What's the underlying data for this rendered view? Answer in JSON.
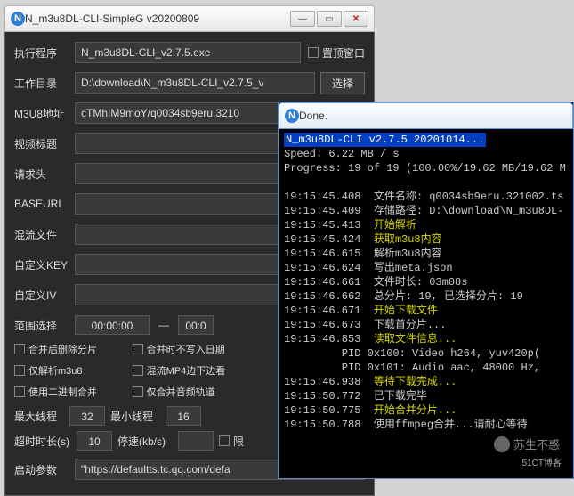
{
  "mainWindow": {
    "title": "N_m3u8DL-CLI-SimpleG v20200809",
    "rows": {
      "exePath": {
        "label": "执行程序",
        "value": "N_m3u8DL-CLI_v2.7.5.exe"
      },
      "topmost": {
        "label": "置顶窗口"
      },
      "workDir": {
        "label": "工作目录",
        "value": "D:\\download\\N_m3u8DL-CLI_v2.7.5_v",
        "btn": "选择"
      },
      "m3u8": {
        "label": "M3U8地址",
        "value": "cTMhIM9moY/q0034sb9eru.3210"
      },
      "videoTitle": {
        "label": "视频标题",
        "value": ""
      },
      "headers": {
        "label": "请求头",
        "value": ""
      },
      "baseurl": {
        "label": "BASEURL",
        "value": ""
      },
      "muxFile": {
        "label": "混流文件",
        "value": ""
      },
      "customKey": {
        "label": "自定义KEY",
        "value": ""
      },
      "customIV": {
        "label": "自定义IV",
        "value": ""
      }
    },
    "range": {
      "label": "范围选择",
      "from": "00:00:00",
      "to": "00:0"
    },
    "checks": {
      "c1": "合并后删除分片",
      "c2": "合并时不写入日期",
      "c3": "",
      "c4": "仅解析m3u8",
      "c5": "混流MP4边下边看",
      "c6": "",
      "c7": "使用二进制合并",
      "c8": "仅合并音频轨道",
      "c9": ""
    },
    "nums": {
      "maxThreadsL": "最大线程",
      "maxThreads": "32",
      "minThreadsL": "最小线程",
      "minThreads": "16",
      "timeoutL": "超时时长(s)",
      "timeout": "10",
      "speedL": "停速(kb/s)",
      "speed": "",
      "limitChk": "限"
    },
    "args": {
      "label": "启动参数",
      "value": "\"https://defaultts.tc.qq.com/defa"
    }
  },
  "consoleWindow": {
    "title": "Done.",
    "header": "N_m3u8DL-CLI v2.7.5 20201014...",
    "speed": "Speed: 6.22 MB / s",
    "progress": "Progress: 19 of 19 (100.00%/19.62 MB/19.62 M",
    "lines": [
      {
        "t": "19:15:45.408",
        "m": "文件名称: q0034sb9eru.321002.ts"
      },
      {
        "t": "19:15:45.409",
        "m": "存储路径: D:\\download\\N_m3u8DL-"
      },
      {
        "t": "19:15:45.413",
        "m": "开始解析",
        "y": true
      },
      {
        "t": "19:15:45.424",
        "m": "获取m3u8内容",
        "y": true
      },
      {
        "t": "19:15:46.615",
        "m": "解析m3u8内容"
      },
      {
        "t": "19:15:46.624",
        "m": "写出meta.json"
      },
      {
        "t": "19:15:46.661",
        "m": "文件时长: 03m08s"
      },
      {
        "t": "19:15:46.662",
        "m": "总分片: 19, 已选择分片: 19"
      },
      {
        "t": "19:15:46.671",
        "m": "开始下载文件",
        "y": true
      },
      {
        "t": "19:15:46.673",
        "m": "下载首分片..."
      },
      {
        "t": "19:15:46.853",
        "m": "读取文件信息...",
        "y": true
      },
      {
        "t": "",
        "m": "         PID 0x100: Video h264, yuv420p("
      },
      {
        "t": "",
        "m": "         PID 0x101: Audio aac, 48000 Hz,"
      },
      {
        "t": "19:15:46.938",
        "m": "等待下载完成...",
        "y": true
      },
      {
        "t": "19:15:50.772",
        "m": "已下载完毕"
      },
      {
        "t": "19:15:50.775",
        "m": "开始合并分片...",
        "y": true
      },
      {
        "t": "19:15:50.788",
        "m": "使用ffmpeg合并...请耐心等待"
      }
    ]
  },
  "watermark": {
    "text": "苏生不惑",
    "sub": "51CT博客"
  }
}
